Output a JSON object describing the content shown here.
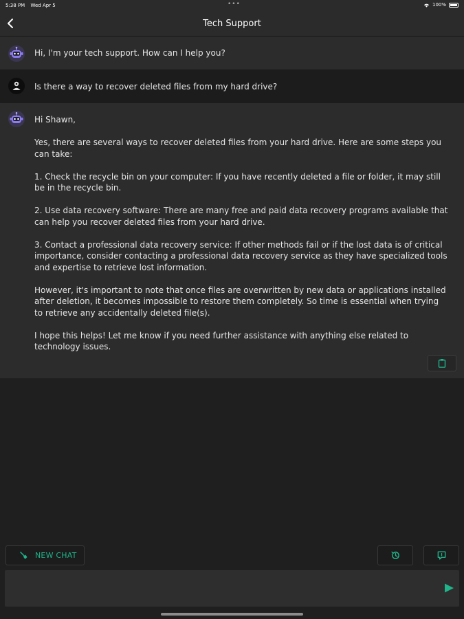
{
  "status_bar": {
    "time": "5:38 PM",
    "date": "Wed Apr 5",
    "battery": "100%"
  },
  "header": {
    "title": "Tech Support"
  },
  "messages": [
    {
      "role": "bot",
      "paragraphs": [
        "Hi, I'm your tech support. How can I help you?"
      ]
    },
    {
      "role": "user",
      "paragraphs": [
        "Is there a way to recover deleted files from my hard drive?"
      ]
    },
    {
      "role": "bot",
      "paragraphs": [
        "Hi Shawn,",
        "Yes, there are several ways to recover deleted files from your hard drive. Here are some steps you can take:",
        "1. Check the recycle bin on your computer: If you have recently deleted a file or folder, it may still be in the recycle bin.",
        "2. Use data recovery software: There are many free and paid data recovery programs available that can help you recover deleted files from your hard drive.",
        "3. Contact a professional data recovery service: If other methods fail or if the lost data is of critical importance, consider contacting a professional data recovery service as they have specialized tools and expertise to retrieve lost information.",
        "However, it's important to note that once files are overwritten by new data or applications installed after deletion, it becomes impossible to restore them completely. So time is essential when trying to retrieve any accidentally deleted file(s).",
        "I hope this helps! Let me know if you need further assistance with anything else related to technology issues."
      ]
    }
  ],
  "toolbar": {
    "new_chat_label": "NEW CHAT"
  },
  "composer": {
    "value": "",
    "placeholder": ""
  },
  "colors": {
    "accent": "#1fb48a",
    "bot_row_bg": "#2c2c2c",
    "user_row_bg": "#1c1c1c",
    "app_bg": "#1f1f1f",
    "bot_avatar": "#8b7cf0"
  },
  "icons": {
    "back": "chevron-left-icon",
    "bot_avatar": "robot-icon",
    "user_avatar": "user-icon",
    "copy": "clipboard-icon",
    "new_chat": "broom-icon",
    "history": "history-icon",
    "prompts": "chat-bubble-icon",
    "send": "send-icon"
  }
}
